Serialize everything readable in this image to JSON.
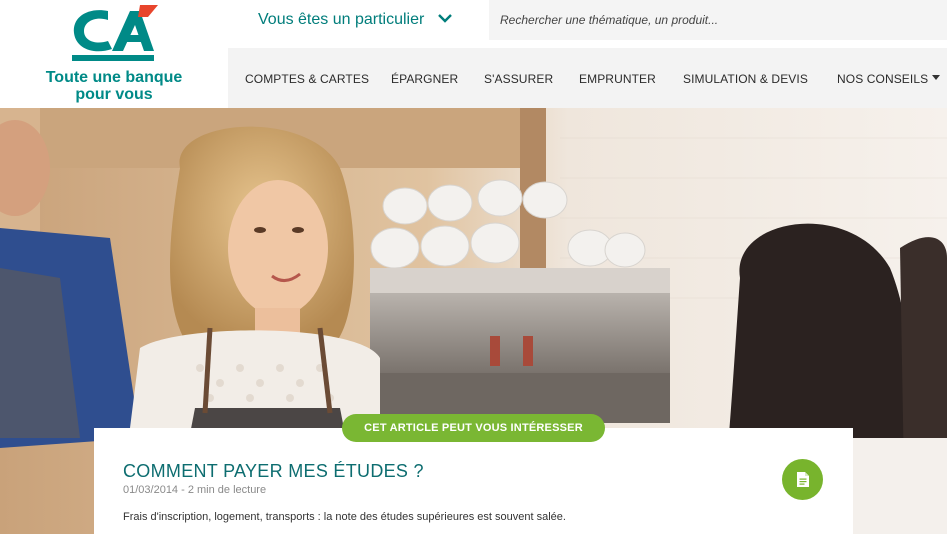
{
  "header": {
    "logo_alt": "Crédit Agricole",
    "tagline_line1": "Toute une banque",
    "tagline_line2": "pour vous",
    "persona_label": "Vous êtes un particulier",
    "search_placeholder": "Rechercher une thématique, un produit..."
  },
  "nav": {
    "items": [
      {
        "label": "COMPTES & CARTES"
      },
      {
        "label": "ÉPARGNER"
      },
      {
        "label": "S'ASSURER"
      },
      {
        "label": "EMPRUNTER"
      },
      {
        "label": "SIMULATION & DEVIS"
      },
      {
        "label": "NOS CONSEILS"
      }
    ]
  },
  "article": {
    "badge": "CET ARTICLE PEUT VOUS INTÉRESSER",
    "title": "COMMENT PAYER MES ÉTUDES ?",
    "meta": "01/03/2014 - 2 min de lecture",
    "description": "Frais d'inscription, logement, transports : la note des études supérieures est souvent salée."
  },
  "colors": {
    "brand_teal": "#007d7b",
    "brand_green": "#7ab733",
    "logo_red": "#e8452c"
  },
  "icons": {
    "persona_chevron": "chevron-down-icon",
    "nav_caret": "caret-down-icon",
    "article_doc": "document-icon"
  }
}
